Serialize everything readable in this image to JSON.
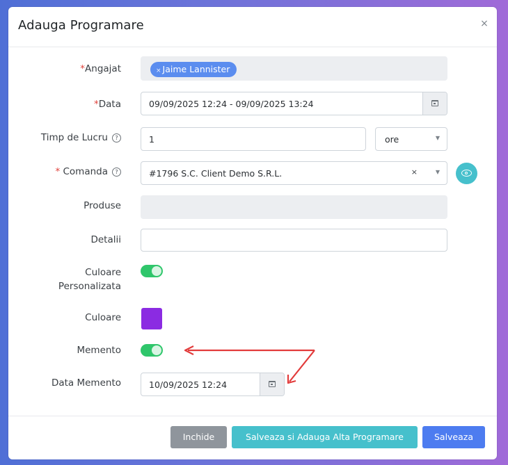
{
  "modal": {
    "title": "Adauga Programare",
    "close_glyph": "×"
  },
  "form": {
    "angajat": {
      "required_mark": "*",
      "label": "Angajat",
      "tag_remove": "×",
      "tag": "Jaime Lannister"
    },
    "data": {
      "required_mark": "*",
      "label": "Data",
      "value": "09/09/2025 12:24 - 09/09/2025 13:24",
      "icon": "calendar-icon"
    },
    "timp_de_lucru": {
      "label": "Timp de Lucru",
      "help": "?",
      "value": "1",
      "unit": "ore",
      "caret": "▼"
    },
    "comanda": {
      "required_mark": "*",
      "label": "Comanda",
      "help": "?",
      "value": "#1796 S.C. Client Demo S.R.L.",
      "clear": "×",
      "caret": "▼",
      "action_icon": "eye-icon"
    },
    "produse": {
      "label": "Produse",
      "value": ""
    },
    "detalii": {
      "label": "Detalii",
      "value": ""
    },
    "culoare_personalizata": {
      "label_line1": "Culoare",
      "label_line2": "Personalizata",
      "enabled": true
    },
    "culoare": {
      "label": "Culoare",
      "color": "#8b2be2"
    },
    "memento": {
      "label": "Memento",
      "enabled": true
    },
    "data_memento": {
      "label": "Data Memento",
      "value": "10/09/2025 12:24",
      "icon": "calendar-icon"
    }
  },
  "footer": {
    "close_label": "Inchide",
    "save_add_label": "Salveaza si Adauga Alta Programare",
    "save_label": "Salveaza"
  },
  "colors": {
    "primary": "#4d7cf0",
    "info": "#46c0cc",
    "secondary": "#8f959c",
    "toggle_on": "#2fc66b",
    "required": "#e0433d",
    "annotation_arrow": "#e23b3b"
  }
}
